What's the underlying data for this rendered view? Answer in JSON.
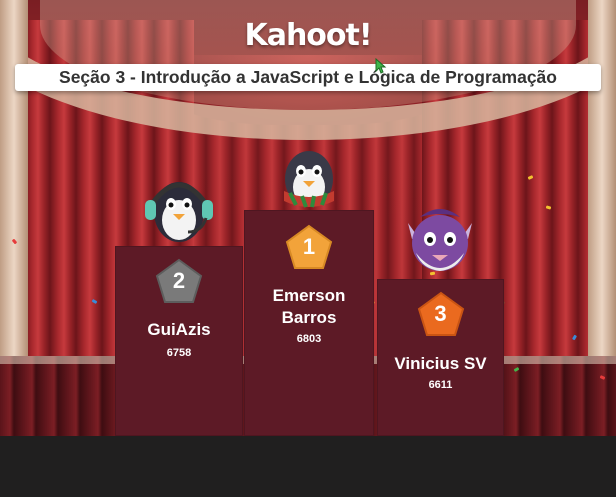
{
  "header": {
    "logo_text": "Kahoot!",
    "title": "Seção 3 - Introdução a JavaScript e Lógica de Programação"
  },
  "podium": [
    {
      "rank": "1",
      "name_line1": "Emerson",
      "name_line2": "Barros",
      "score": "6803",
      "badge_color": "#f2a33a"
    },
    {
      "rank": "2",
      "name": "GuiAzis",
      "score": "6758",
      "badge_color": "#7a7a7a"
    },
    {
      "rank": "3",
      "name": "Vinicius SV",
      "score": "6611",
      "badge_color": "#ea6a1f"
    }
  ],
  "colors": {
    "podium": "#5d1a26",
    "title_bar": "#ffffff"
  },
  "icons": {
    "logo": "kahoot-logo",
    "cursor": "mouse-cursor-icon"
  }
}
